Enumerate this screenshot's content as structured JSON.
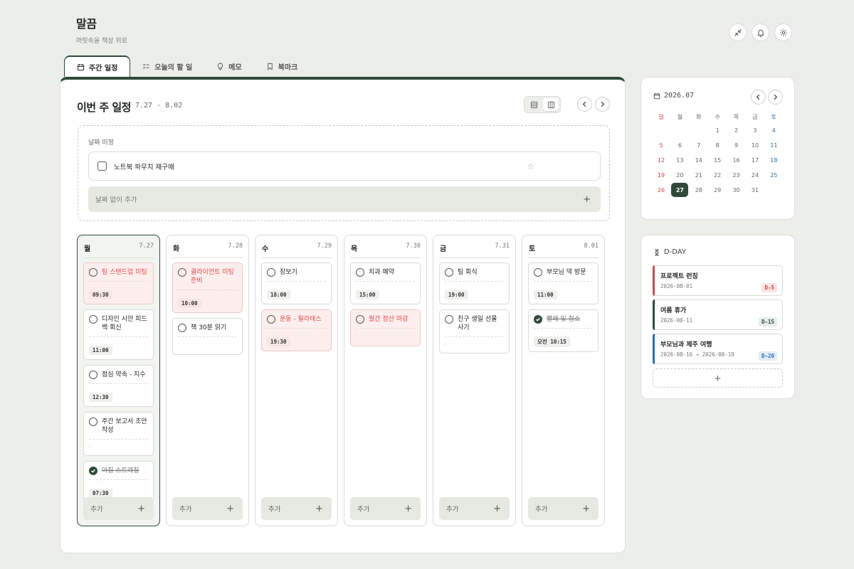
{
  "app": {
    "title": "말끔",
    "subtitle": "머릿속을 책상 위로"
  },
  "tabs": [
    {
      "label": "주간 일정",
      "icon": "calendar-icon",
      "active": true
    },
    {
      "label": "오늘의 할 일",
      "icon": "checklist-icon",
      "active": false
    },
    {
      "label": "메모",
      "icon": "lightbulb-icon",
      "active": false
    },
    {
      "label": "북마크",
      "icon": "bookmark-icon",
      "active": false
    }
  ],
  "week": {
    "title": "이번 주 일정",
    "range": "7.27 - 8.02"
  },
  "undated": {
    "label": "날짜 미정",
    "tasks": [
      {
        "text": "노트북 파우치 재구매",
        "done": false,
        "starred": false
      }
    ],
    "add_placeholder": "날짜 없이 추가"
  },
  "days": [
    {
      "name": "월",
      "date": "7.27",
      "today": true,
      "tasks": [
        {
          "text": "팀 스탠드업 미팅",
          "time": "09:30",
          "red": true,
          "done": false
        },
        {
          "text": "디자인 시안 피드백 회신",
          "time": "11:00",
          "red": false,
          "done": false
        },
        {
          "text": "점심 약속 - 지수",
          "time": "12:30",
          "red": false,
          "done": false
        },
        {
          "text": "주간 보고서 초안 작성",
          "time": "",
          "red": false,
          "done": false
        },
        {
          "text": "아침 스트레칭",
          "time": "07:30",
          "red": false,
          "done": true
        }
      ]
    },
    {
      "name": "화",
      "date": "7.28",
      "today": false,
      "tasks": [
        {
          "text": "클라이언트 미팅 준비",
          "time": "10:00",
          "red": true,
          "done": false
        },
        {
          "text": "책 30분 읽기",
          "time": "",
          "red": false,
          "done": false
        }
      ]
    },
    {
      "name": "수",
      "date": "7.29",
      "today": false,
      "tasks": [
        {
          "text": "장보기",
          "time": "18:00",
          "red": false,
          "done": false
        },
        {
          "text": "운동 - 필라테스",
          "time": "19:30",
          "red": true,
          "done": false
        }
      ]
    },
    {
      "name": "목",
      "date": "7.30",
      "today": false,
      "tasks": [
        {
          "text": "치과 예약",
          "time": "15:00",
          "red": false,
          "done": false
        },
        {
          "text": "월간 정산 마감",
          "time": "",
          "red": true,
          "done": false
        }
      ]
    },
    {
      "name": "금",
      "date": "7.31",
      "today": false,
      "tasks": [
        {
          "text": "팀 회식",
          "time": "19:00",
          "red": false,
          "done": false
        },
        {
          "text": "친구 생일 선물 사기",
          "time": "",
          "red": false,
          "done": false
        }
      ]
    },
    {
      "name": "토",
      "date": "8.01",
      "today": false,
      "tasks": [
        {
          "text": "부모님 댁 방문",
          "time": "11:00",
          "red": false,
          "done": false
        },
        {
          "text": "빨래 및 청소",
          "time": "오전 10:15",
          "red": false,
          "done": true
        }
      ]
    }
  ],
  "day_add_label": "추가",
  "calendar": {
    "title": "2026.07",
    "weekdays": [
      "일",
      "월",
      "화",
      "수",
      "목",
      "금",
      "토"
    ],
    "first_weekday": 3,
    "days_in_month": 31,
    "today": 27,
    "colors": {
      "sunday": "#d04040",
      "saturday": "#2e6bb0"
    }
  },
  "dday": {
    "title": "D-DAY",
    "items": [
      {
        "name": "프로젝트 런칭",
        "date": "2026-08-01",
        "badge": "D-5",
        "color": "#c05050",
        "badge_bg": "#fbe3e3",
        "badge_fg": "#d04040"
      },
      {
        "name": "여름 휴가",
        "date": "2026-08-11",
        "badge": "D-15",
        "color": "#2f4a3a",
        "badge_bg": "#e6ece7",
        "badge_fg": "#2f4a3a"
      },
      {
        "name": "부모님과 제주 여행",
        "date": "2026-08-16 → 2026-08-19",
        "badge": "D-20",
        "color": "#2e6bb0",
        "badge_bg": "#e1ecf7",
        "badge_fg": "#2e6bb0"
      }
    ]
  },
  "header_icons": [
    "collapse-icon",
    "bell-icon",
    "gear-icon"
  ],
  "colors": {
    "accent": "#2f4a3a",
    "red": "#e04b4b",
    "background": "#ecefe9"
  }
}
